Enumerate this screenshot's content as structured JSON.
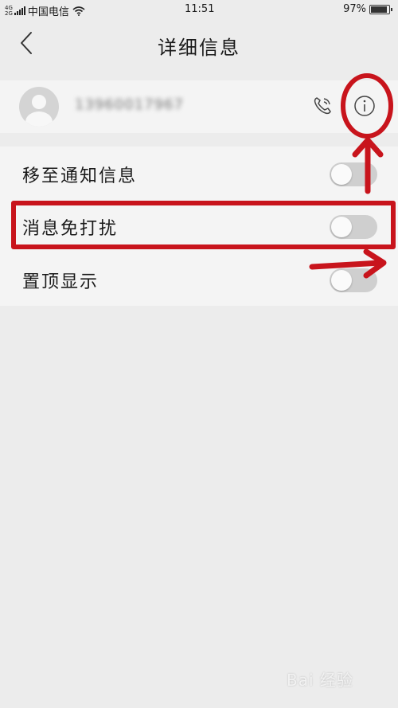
{
  "status_bar": {
    "network_top": "4G",
    "network_bottom": "2G",
    "carrier": "中国电信",
    "time": "11:51",
    "battery_text": "97%",
    "battery_level": 0.97
  },
  "header": {
    "title": "详细信息"
  },
  "contact": {
    "phone_number": "13960017967"
  },
  "settings": [
    {
      "label": "移至通知信息",
      "enabled": false
    },
    {
      "label": "消息免打扰",
      "enabled": false
    },
    {
      "label": "置顶显示",
      "enabled": false
    }
  ],
  "annotation_color": "#c8141c",
  "watermark": "Bai 经验"
}
